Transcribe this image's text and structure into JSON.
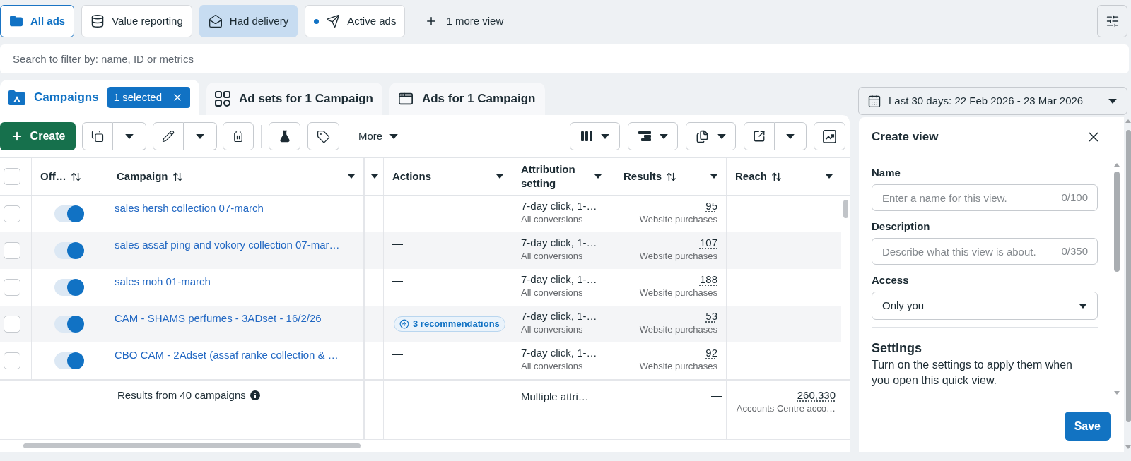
{
  "views": [
    {
      "label": "All ads",
      "selected": true,
      "applied": false,
      "marked": false
    },
    {
      "label": "Value reporting",
      "selected": false,
      "applied": false,
      "marked": false
    },
    {
      "label": "Had delivery",
      "selected": false,
      "applied": true,
      "marked": false
    },
    {
      "label": "Active ads",
      "selected": false,
      "applied": false,
      "marked": true
    }
  ],
  "more_views": "1 more view",
  "search": {
    "placeholder": "Search to filter by: name, ID or metrics"
  },
  "level_tabs": [
    {
      "label": "Campaigns",
      "selected": true,
      "badge": "1 selected"
    },
    {
      "label": "Ad sets for 1 Campaign",
      "selected": false
    },
    {
      "label": "Ads for 1 Campaign",
      "selected": false
    }
  ],
  "date_range": "Last 30 days: 22 Feb 2026 - 23 Mar 2026",
  "toolbar": {
    "create": "Create",
    "more": "More"
  },
  "table": {
    "select_all_checked": false,
    "columns": [
      {
        "label": "Off…",
        "sortable": true,
        "menu": false
      },
      {
        "label": "Campaign",
        "sortable": true,
        "menu": true
      },
      {
        "sortable": false,
        "menu": true
      },
      {
        "label": "Actions",
        "sortable": false,
        "menu": true
      },
      {
        "label": "Attribution setting",
        "sortable": false,
        "menu": true
      },
      {
        "label": "Results",
        "sortable": true,
        "menu": true
      },
      {
        "label": "Reach",
        "sortable": true,
        "menu": true
      }
    ],
    "rows": [
      {
        "selected": false,
        "on": true,
        "campaign": "sales hersh collection 07-march",
        "actions": {
          "kind": "none",
          "text": "—"
        },
        "attribution": "7-day click, 1-…",
        "attribution_note": "All conversions",
        "results": "95",
        "results_label": "Website purchases"
      },
      {
        "selected": false,
        "on": true,
        "campaign": "sales assaf ping and vokory collection 07-mar…",
        "actions": {
          "kind": "none",
          "text": "—"
        },
        "attribution": "7-day click, 1-…",
        "attribution_note": "All conversions",
        "results": "107",
        "results_label": "Website purchases"
      },
      {
        "selected": false,
        "on": true,
        "campaign": "sales moh 01-march",
        "actions": {
          "kind": "none",
          "text": "—"
        },
        "attribution": "7-day click, 1-…",
        "attribution_note": "All conversions",
        "results": "188",
        "results_label": "Website purchases"
      },
      {
        "selected": false,
        "on": true,
        "campaign": "CAM - SHAMS perfumes - 3ADset - 16/2/26",
        "actions": {
          "kind": "recommendations",
          "text": "3 recommendations"
        },
        "attribution": "7-day click, 1-…",
        "attribution_note": "All conversions",
        "results": "53",
        "results_label": "Website purchases"
      },
      {
        "selected": false,
        "on": true,
        "campaign": "CBO CAM - 2Adset (assaf ranke collection & …",
        "actions": {
          "kind": "none",
          "text": "—"
        },
        "attribution": "7-day click, 1-…",
        "attribution_note": "All conversions",
        "results": "92",
        "results_label": "Website purchases"
      }
    ],
    "summary": {
      "label": "Results from 40 campaigns",
      "attribution": "Multiple attri…",
      "results": "—",
      "reach": "260,330",
      "reach_label": "Accounts Centre acco…"
    }
  },
  "create_view": {
    "title": "Create view",
    "fields": [
      {
        "label": "Name",
        "placeholder": "Enter a name for this view.",
        "counter": "0/100"
      },
      {
        "label": "Description",
        "placeholder": "Describe what this view is about.",
        "counter": "0/350"
      }
    ],
    "access": {
      "label": "Access",
      "value": "Only you"
    },
    "settings": {
      "title": "Settings",
      "description": "Turn on the settings to apply them when you open this quick view."
    },
    "save": "Save"
  }
}
